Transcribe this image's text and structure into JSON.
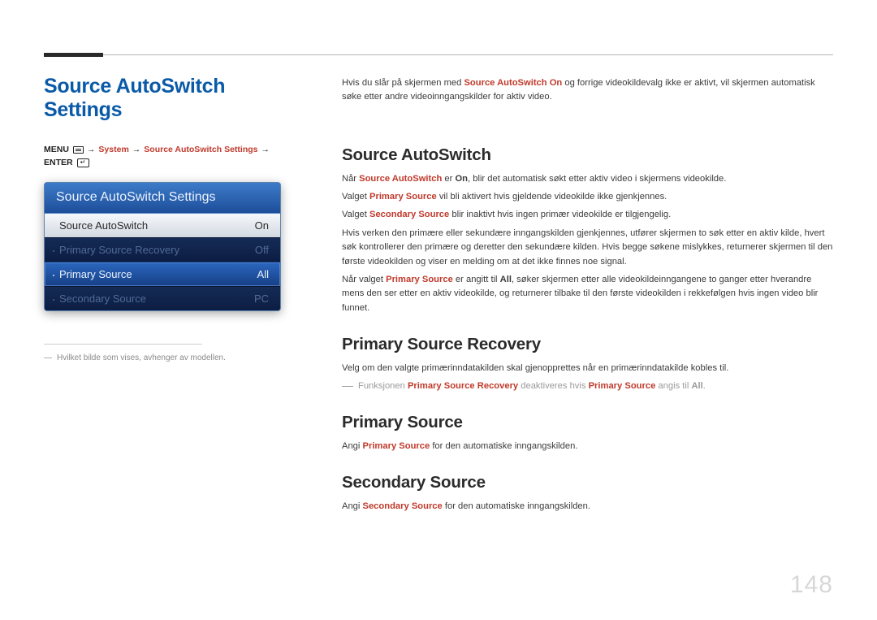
{
  "page_number": "148",
  "title": "Source AutoSwitch Settings",
  "breadcrumb": {
    "menu": "MENU",
    "system": "System",
    "settings": "Source AutoSwitch Settings",
    "enter": "ENTER"
  },
  "panel": {
    "header": "Source AutoSwitch Settings",
    "rows": [
      {
        "label": "Source AutoSwitch",
        "value": "On"
      },
      {
        "label": "Primary Source Recovery",
        "value": "Off"
      },
      {
        "label": "Primary Source",
        "value": "All"
      },
      {
        "label": "Secondary Source",
        "value": "PC"
      }
    ]
  },
  "footnote": "Hvilket bilde som vises, avhenger av modellen.",
  "intro": {
    "p1_a": "Hvis du slår på skjermen med ",
    "p1_accent": "Source AutoSwitch On",
    "p1_b": " og forrige videokildevalg ikke er aktivt, vil skjermen automatisk søke etter andre videoinngangskilder for aktiv video."
  },
  "s1": {
    "heading": "Source AutoSwitch",
    "p1_a": "Når ",
    "p1_accent": "Source AutoSwitch",
    "p1_b": " er ",
    "p1_bold": "On",
    "p1_c": ", blir det automatisk søkt etter aktiv video i skjermens videokilde.",
    "p2_a": "Valget ",
    "p2_accent": "Primary Source",
    "p2_b": " vil bli aktivert hvis gjeldende videokilde ikke gjenkjennes.",
    "p3_a": "Valget ",
    "p3_accent": "Secondary Source",
    "p3_b": " blir inaktivt hvis ingen primær videokilde er tilgjengelig.",
    "p4": "Hvis verken den primære eller sekundære inngangskilden gjenkjennes, utfører skjermen to søk etter en aktiv kilde, hvert søk kontrollerer den primære og deretter den sekundære kilden. Hvis begge søkene mislykkes, returnerer skjermen til den første videokilden og viser en melding om at det ikke finnes noe signal.",
    "p5_a": "Når valget ",
    "p5_accent": "Primary Source",
    "p5_b": " er angitt til ",
    "p5_bold": "All",
    "p5_c": ", søker skjermen etter alle videokildeinngangene to ganger etter hverandre mens den ser etter en aktiv videokilde, og returnerer tilbake til den første videokilden i rekkefølgen hvis ingen video blir funnet."
  },
  "s2": {
    "heading": "Primary Source Recovery",
    "p1": "Velg om den valgte primærinndatakilden skal gjenopprettes når en primærinndatakilde kobles til.",
    "note_a": "Funksjonen ",
    "note_accent1": "Primary Source Recovery",
    "note_b": " deaktiveres hvis ",
    "note_accent2": "Primary Source",
    "note_c": " angis til ",
    "note_bold": "All",
    "note_d": "."
  },
  "s3": {
    "heading": "Primary Source",
    "p1_a": "Angi ",
    "p1_accent": "Primary Source",
    "p1_b": " for den automatiske inngangskilden."
  },
  "s4": {
    "heading": "Secondary Source",
    "p1_a": "Angi ",
    "p1_accent": "Secondary Source",
    "p1_b": " for den automatiske inngangskilden."
  }
}
